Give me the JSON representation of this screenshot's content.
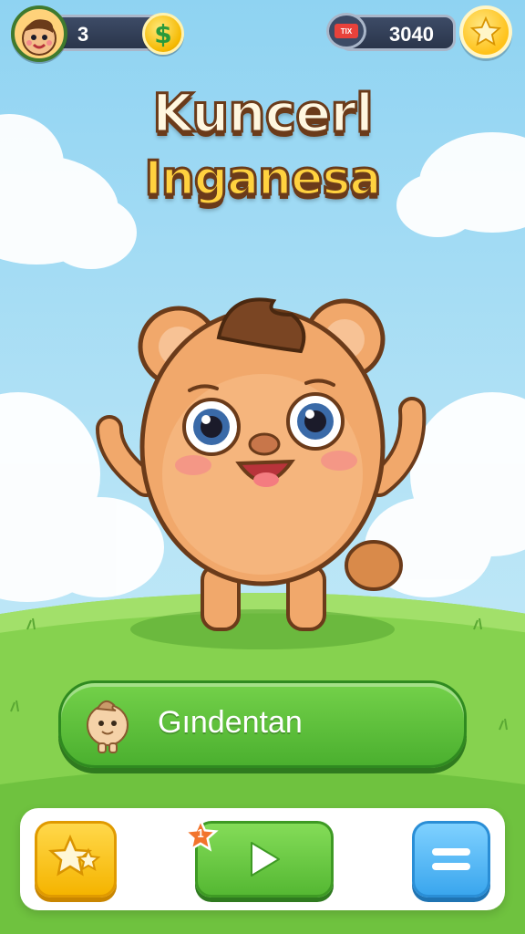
{
  "hud": {
    "left_counter": "3",
    "coin_symbol": "$",
    "right_counter": "3040",
    "ticket_label": "TIX"
  },
  "title": {
    "line1": "Kuncerl",
    "line2": "Inganesa"
  },
  "cta": {
    "label": "Gındentan"
  },
  "tray": {
    "play_badge": "1"
  },
  "colors": {
    "sky": "#8fd3f2",
    "grass": "#7fd24a",
    "cta_green": "#5dbf36",
    "title_brown": "#6b3b1a",
    "star_yellow": "#ffc21a",
    "menu_blue": "#3aa6ee"
  },
  "icons": [
    "avatar-boy-icon",
    "dollar-coin-icon",
    "ticket-icon",
    "star-icon",
    "play-icon",
    "menu-icon",
    "mascot-icon"
  ]
}
